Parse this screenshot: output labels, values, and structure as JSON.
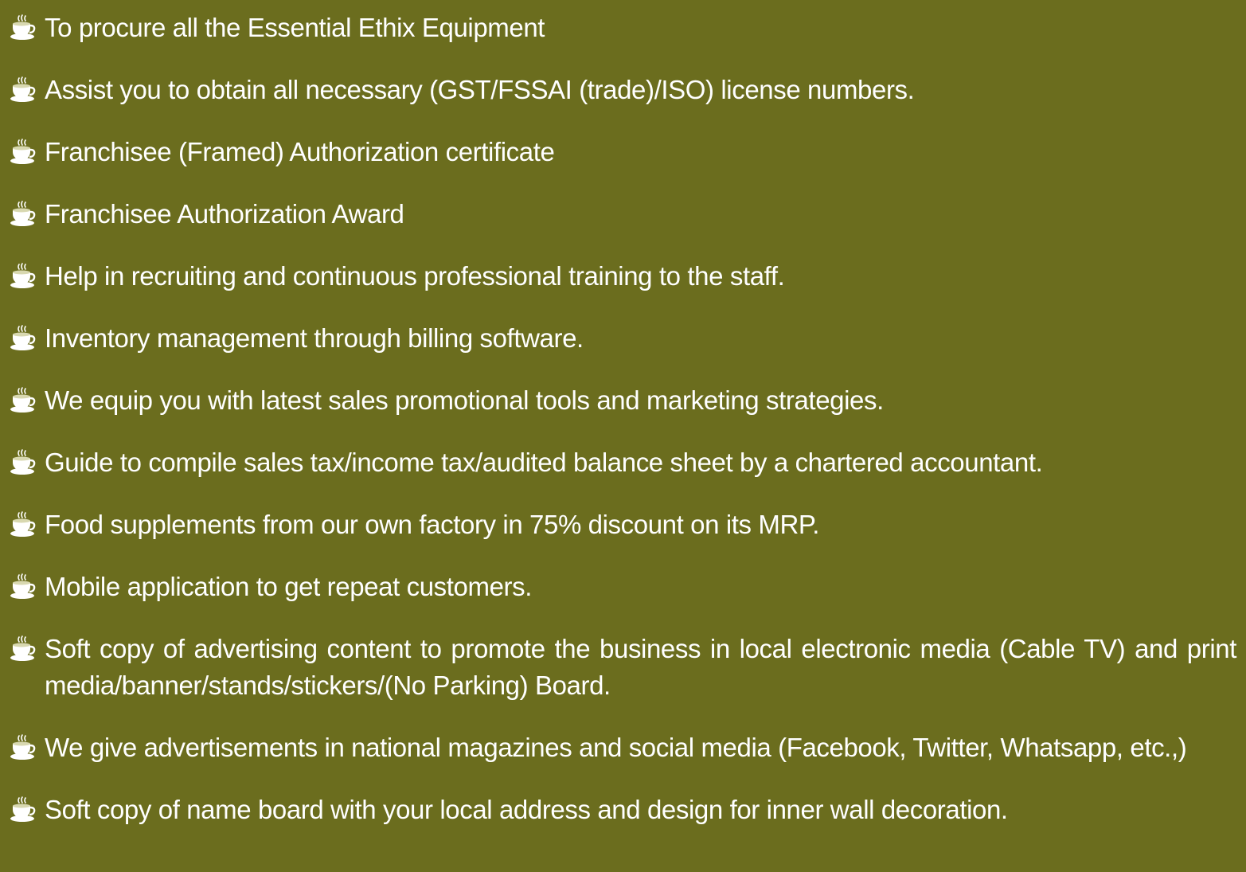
{
  "bullet_icon": "coffee-cup-icon",
  "colors": {
    "background": "#6b6d1e",
    "text": "#ffffff"
  },
  "items": [
    "To procure all the Essential Ethix Equipment",
    "Assist you to obtain all necessary (GST/FSSAI (trade)/ISO) license numbers.",
    "Franchisee (Framed) Authorization certificate",
    "Franchisee Authorization Award",
    "Help in recruiting and continuous professional training to the staff.",
    "Inventory management through billing software.",
    "We equip you with latest sales promotional tools and marketing strategies.",
    "Guide to compile sales tax/income tax/audited balance sheet by a chartered accountant.",
    "Food supplements from our own factory in 75% discount on its MRP.",
    "Mobile application to get repeat customers.",
    "Soft copy of advertising content to promote the business in local electronic media (Cable TV) and print media/banner/stands/stickers/(No Parking) Board.",
    "We give advertisements in national magazines and social media (Facebook, Twitter, Whatsapp, etc.,)",
    "Soft copy of name board with your local address and design for inner wall decoration."
  ]
}
